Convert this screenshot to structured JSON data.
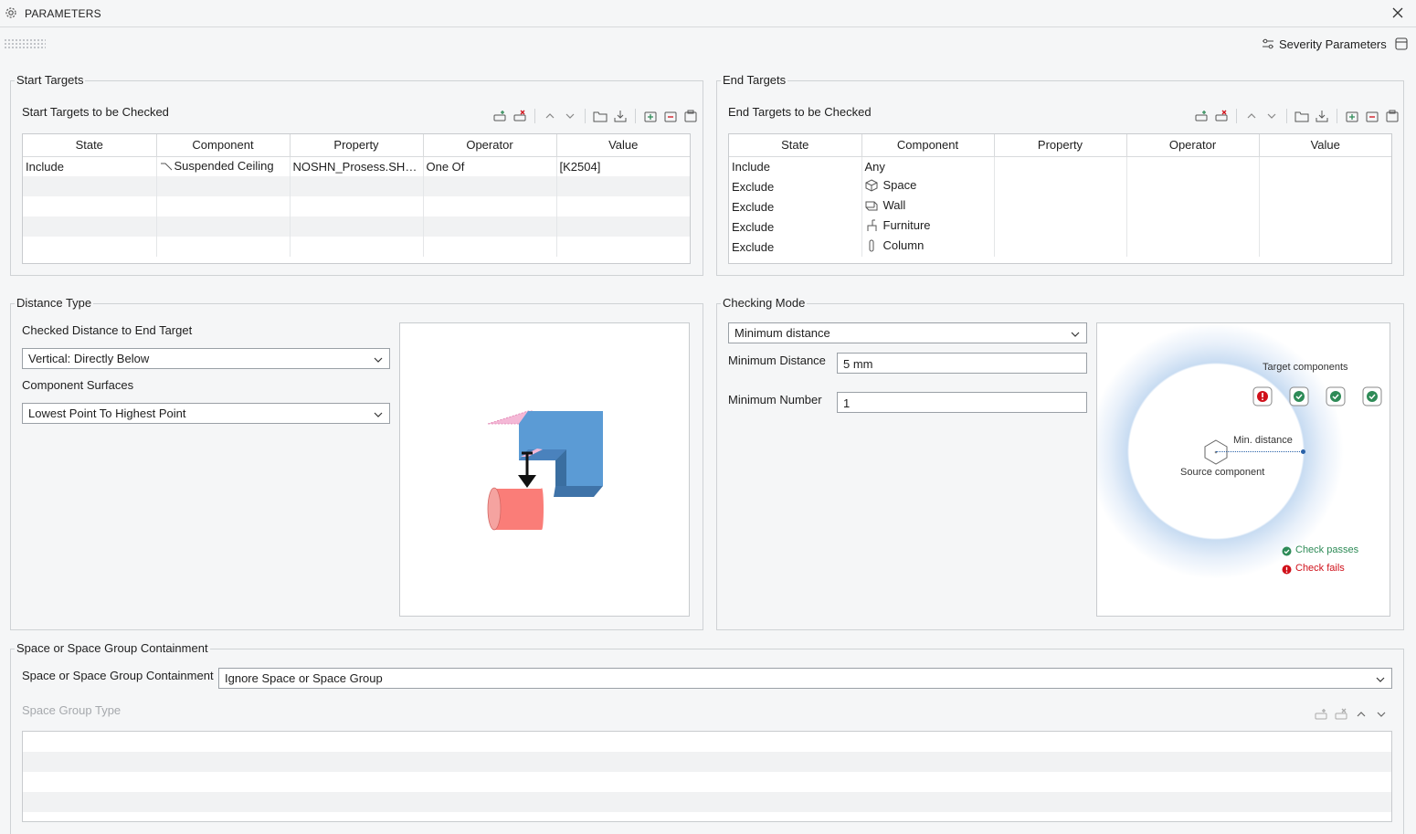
{
  "window": {
    "title": "PARAMETERS"
  },
  "header": {
    "severity_label": "Severity Parameters"
  },
  "start_targets": {
    "legend": "Start Targets",
    "table_title": "Start Targets to be Checked",
    "columns": [
      "State",
      "Component",
      "Property",
      "Operator",
      "Value"
    ],
    "rows": [
      {
        "state": "Include",
        "component": "Suspended Ceiling",
        "property": "NOSHN_Prosess.SHN_...",
        "operator": "One Of",
        "value": "[K2504]"
      }
    ]
  },
  "end_targets": {
    "legend": "End Targets",
    "table_title": "End Targets to be Checked",
    "columns": [
      "State",
      "Component",
      "Property",
      "Operator",
      "Value"
    ],
    "rows": [
      {
        "state": "Include",
        "component": "Any",
        "icon": ""
      },
      {
        "state": "Exclude",
        "component": "Space",
        "icon": "cube-icon"
      },
      {
        "state": "Exclude",
        "component": "Wall",
        "icon": "wall-icon"
      },
      {
        "state": "Exclude",
        "component": "Furniture",
        "icon": "chair-icon"
      },
      {
        "state": "Exclude",
        "component": "Column",
        "icon": "column-icon"
      }
    ]
  },
  "distance_type": {
    "legend": "Distance Type",
    "checked_distance_label": "Checked Distance to End Target",
    "checked_distance_value": "Vertical: Directly Below",
    "surfaces_label": "Component Surfaces",
    "surfaces_value": "Lowest Point To Highest Point"
  },
  "checking_mode": {
    "legend": "Checking Mode",
    "mode_value": "Minimum distance",
    "min_distance_label": "Minimum Distance",
    "min_distance_value": "5 mm",
    "min_number_label": "Minimum Number",
    "min_number_value": "1",
    "diagram": {
      "target_components": "Target components",
      "min_distance": "Min. distance",
      "source_component": "Source component",
      "check_passes": "Check passes",
      "check_fails": "Check fails",
      "pass_color": "#2e8b57",
      "fail_color": "#d0101a"
    }
  },
  "containment": {
    "legend": "Space or Space Group Containment",
    "label": "Space or Space Group Containment",
    "value": "Ignore Space or Space Group",
    "group_type_label": "Space Group Type"
  }
}
